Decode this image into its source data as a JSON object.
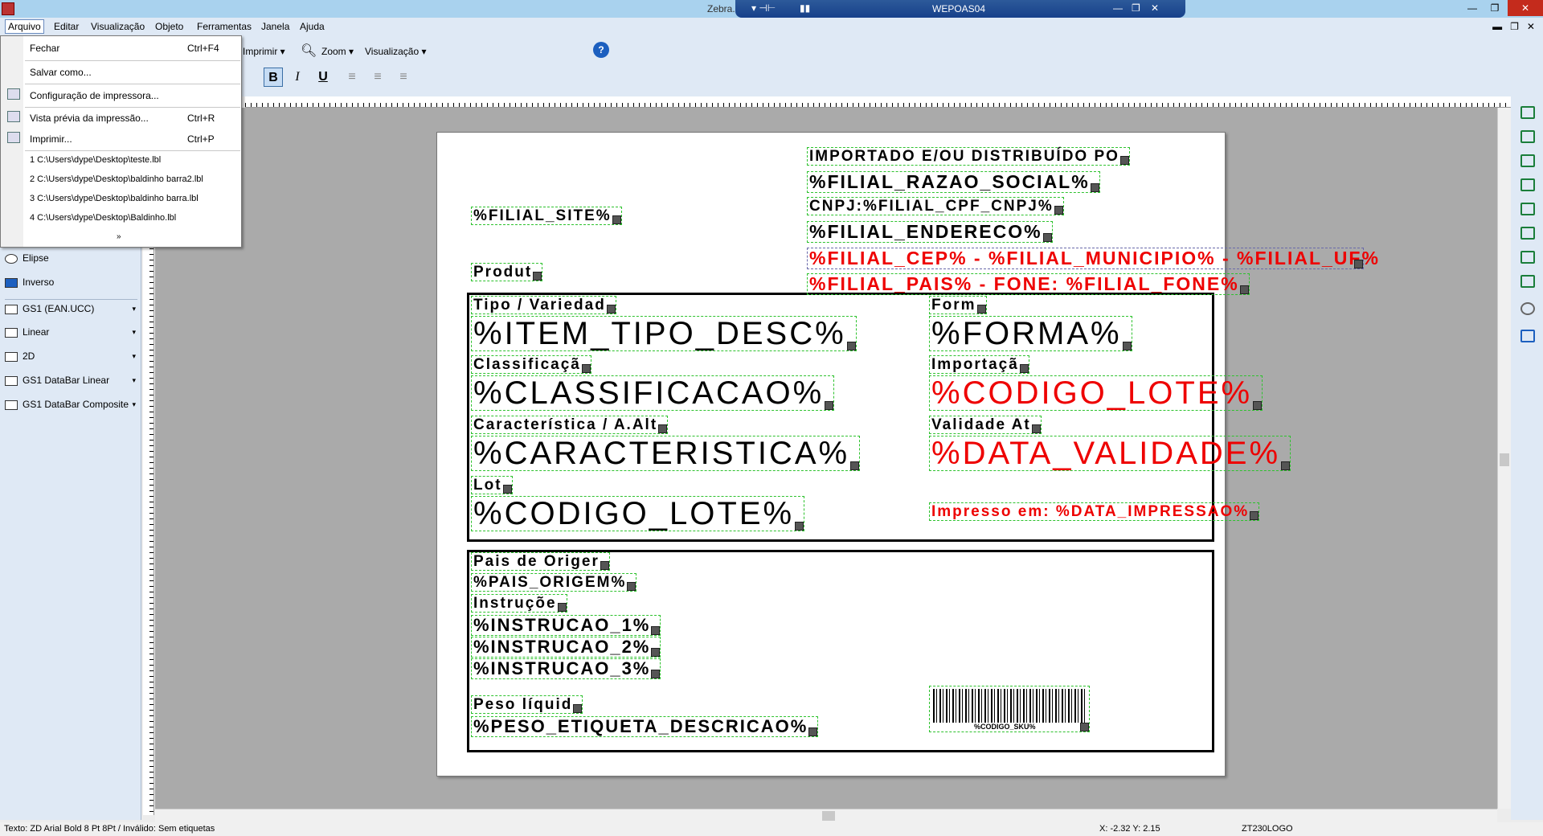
{
  "title_bar": {
    "app_title": "Zebra...",
    "remote_title": "WEPOAS04"
  },
  "menubar": [
    "Arquivo",
    "Editar",
    "Visualização",
    "Objeto",
    "Ferramentas",
    "Janela",
    "Ajuda"
  ],
  "toolbar": {
    "print_label": "Imprimir",
    "zoom_label": "Zoom",
    "view_label": "Visualização"
  },
  "file_menu": {
    "items": [
      {
        "label": "Fechar",
        "shortcut": "Ctrl+F4"
      },
      {
        "label": "Salvar como..."
      },
      {
        "label": "Configuração de impressora..."
      },
      {
        "label": "Vista prévia da impressão...",
        "shortcut": "Ctrl+R"
      },
      {
        "label": "Imprimir...",
        "shortcut": "Ctrl+P"
      }
    ],
    "recent": [
      "1 C:\\Users\\dype\\Desktop\\teste.lbl",
      "2 C:\\Users\\dype\\Desktop\\baldinho barra2.lbl",
      "3 C:\\Users\\dype\\Desktop\\baldinho barra.lbl",
      "4 C:\\Users\\dype\\Desktop\\Baldinho.lbl"
    ]
  },
  "left_panel": [
    "Elipse",
    "Inverso",
    "GS1 (EAN.UCC)",
    "Linear",
    "2D",
    "GS1 DataBar Linear",
    "GS1 DataBar Composite"
  ],
  "label": {
    "importado": "IMPORTADO E/OU DISTRIBUÍDO PO",
    "razao": "%FILIAL_RAZAO_SOCIAL%",
    "cnpj": "CNPJ:%FILIAL_CPF_CNPJ%",
    "endereco": "%FILIAL_ENDERECO%",
    "cep": "%FILIAL_CEP% - %FILIAL_MUNICIPIO% - %FILIAL_UF%",
    "pais_fone": "%FILIAL_PAIS% - FONE: %FILIAL_FONE%",
    "site": "%FILIAL_SITE%",
    "produto": "Produt",
    "tipo_lbl": "Tipo / Variedad",
    "tipo_val": "%ITEM_TIPO_DESC%",
    "forma_lbl": "Form",
    "forma_val": "%FORMA%",
    "class_lbl": "Classificaçã",
    "class_val": "%CLASSIFICACAO%",
    "import_lbl": "Importaçã",
    "import_val": "%CODIGO_LOTE%",
    "carac_lbl": "Característica / A.Alt",
    "carac_val": "%CARACTERISTICA%",
    "valid_lbl": "Validade At",
    "valid_val": "%DATA_VALIDADE%",
    "lote_lbl": "Lot",
    "lote_val": "%CODIGO_LOTE%",
    "impresso": "Impresso em: %DATA_IMPRESSAO%",
    "pais_lbl": "Pais de Origer",
    "pais_val": "%PAIS_ORIGEM%",
    "instr_lbl": "Instruçõe",
    "instr1": "%INSTRUCAO_1%",
    "instr2": "%INSTRUCAO_2%",
    "instr3": "%INSTRUCAO_3%",
    "peso_lbl": "Peso líquid",
    "peso_val": "%PESO_ETIQUETA_DESCRICAO%",
    "barcode_text": "%CODIGO_SKU%"
  },
  "status_bar": {
    "left": "Texto: ZD Arial Bold 8 Pt 8Pt  / Inválido: Sem etiquetas",
    "coords": "X: -2.32 Y:  2.15",
    "printer": "ZT230LOGO"
  },
  "colors": {
    "red": "#e00000",
    "accent": "#a9d2ee"
  }
}
